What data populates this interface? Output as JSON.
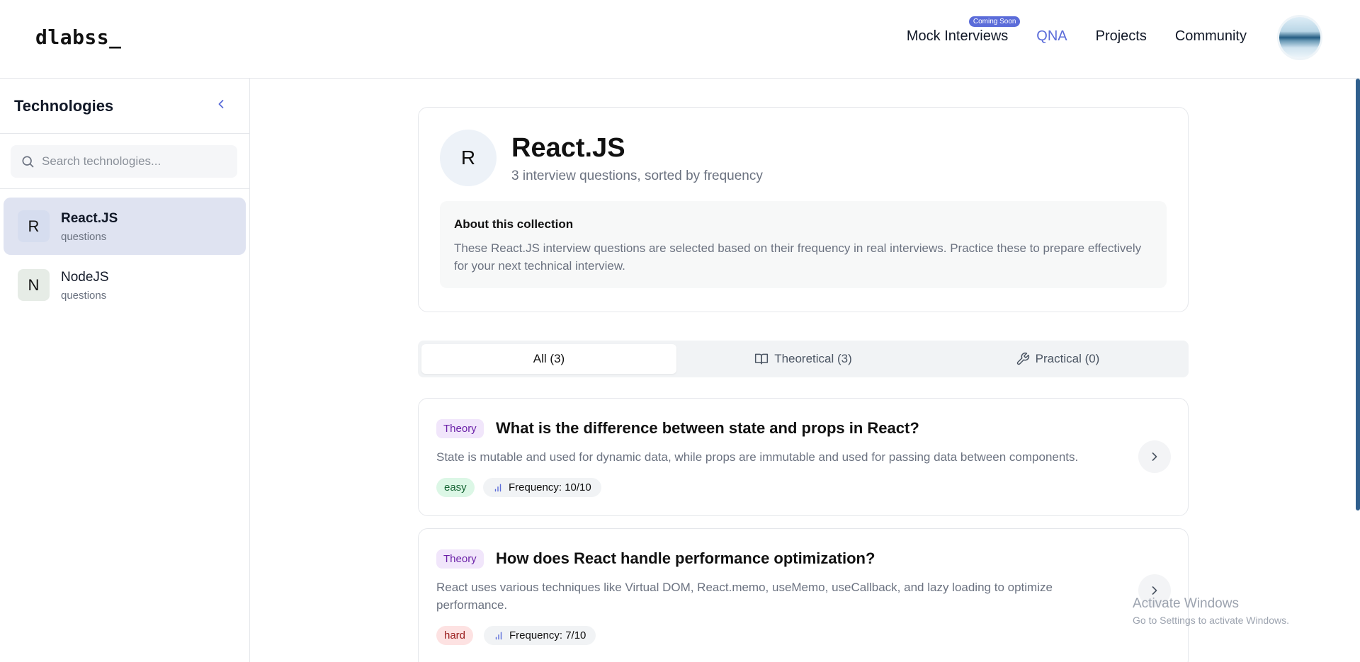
{
  "header": {
    "logo": "dlabss_",
    "nav": [
      {
        "label": "Mock Interviews",
        "badge": "Coming Soon"
      },
      {
        "label": "QNA",
        "active": true
      },
      {
        "label": "Projects"
      },
      {
        "label": "Community"
      }
    ]
  },
  "sidebar": {
    "title": "Technologies",
    "search_placeholder": "Search technologies...",
    "items": [
      {
        "initial": "R",
        "name": "React.JS",
        "sub": "questions",
        "active": true
      },
      {
        "initial": "N",
        "name": "NodeJS",
        "sub": "questions",
        "active": false
      }
    ]
  },
  "collection": {
    "initial": "R",
    "title": "React.JS",
    "subtitle": "3 interview questions, sorted by frequency",
    "about_title": "About this collection",
    "about_text": "These React.JS interview questions are selected based on their frequency in real interviews. Practice these to prepare effectively for your next technical interview."
  },
  "tabs": [
    {
      "label": "All (3)",
      "active": true,
      "icon": null
    },
    {
      "label": "Theoretical (3)",
      "active": false,
      "icon": "book-icon"
    },
    {
      "label": "Practical (0)",
      "active": false,
      "icon": "wrench-icon"
    }
  ],
  "questions": [
    {
      "type": "Theory",
      "title": "What is the difference between state and props in React?",
      "answer": "State is mutable and used for dynamic data, while props are immutable and used for passing data between components.",
      "difficulty": "easy",
      "frequency": "Frequency: 10/10"
    },
    {
      "type": "Theory",
      "title": "How does React handle performance optimization?",
      "answer": "React uses various techniques like Virtual DOM, React.memo, useMemo, useCallback, and lazy loading to optimize performance.",
      "difficulty": "hard",
      "frequency": "Frequency: 7/10"
    }
  ],
  "watermark": {
    "line1": "Activate Windows",
    "line2": "Go to Settings to activate Windows."
  },
  "colors": {
    "accent": "#5b6cd9",
    "theory_badge_bg": "#f1e6fb",
    "easy_bg": "#dcf7e6",
    "hard_bg": "#fde2e2"
  }
}
